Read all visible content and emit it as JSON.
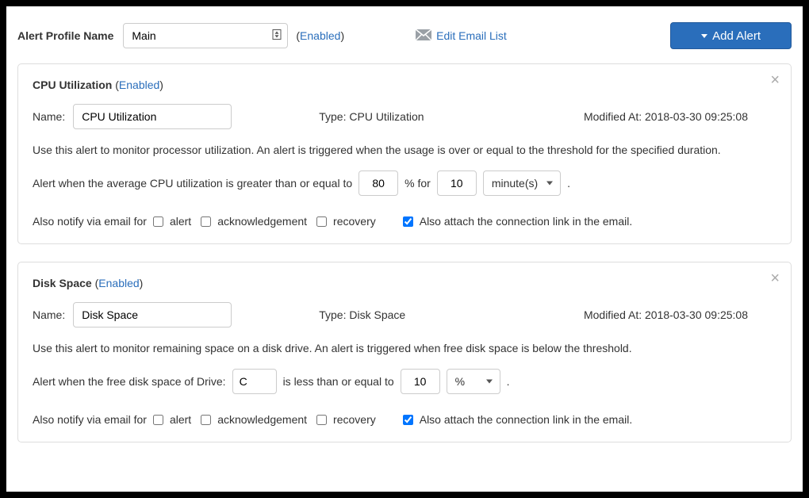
{
  "topbar": {
    "label": "Alert Profile Name",
    "profile_value": "Main",
    "enabled_text": "Enabled",
    "edit_email_label": "Edit Email List",
    "add_alert_label": "Add Alert"
  },
  "alerts": [
    {
      "title": "CPU Utilization",
      "enabled_text": "Enabled",
      "name_label": "Name:",
      "name_value": "CPU Utilization",
      "type_label": "Type:",
      "type_value": "CPU Utilization",
      "modified_label": "Modified At:",
      "modified_value": "2018-03-30 09:25:08",
      "description": "Use this alert to monitor processor utilization. An alert is triggered when the usage is over or equal to the threshold for the specified duration.",
      "config": {
        "prefix": "Alert when the average CPU utilization is greater than or equal to",
        "threshold": "80",
        "pct_for": "% for",
        "duration": "10",
        "unit": "minute(s)"
      },
      "notify": {
        "prefix": "Also notify via email for",
        "alert_label": "alert",
        "ack_label": "acknowledgement",
        "recovery_label": "recovery",
        "attach_label": "Also attach the connection link in the email.",
        "alert_checked": false,
        "ack_checked": false,
        "recovery_checked": false,
        "attach_checked": true
      }
    },
    {
      "title": "Disk Space",
      "enabled_text": "Enabled",
      "name_label": "Name:",
      "name_value": "Disk Space",
      "type_label": "Type:",
      "type_value": "Disk Space",
      "modified_label": "Modified At:",
      "modified_value": "2018-03-30 09:25:08",
      "description": "Use this alert to monitor remaining space on a disk drive. An alert is triggered when free disk space is below the threshold.",
      "config": {
        "prefix": "Alert when the free disk space of Drive:",
        "drive": "C",
        "mid": "is less than or equal to",
        "threshold": "10",
        "unit": "%"
      },
      "notify": {
        "prefix": "Also notify via email for",
        "alert_label": "alert",
        "ack_label": "acknowledgement",
        "recovery_label": "recovery",
        "attach_label": "Also attach the connection link in the email.",
        "alert_checked": false,
        "ack_checked": false,
        "recovery_checked": false,
        "attach_checked": true
      }
    }
  ]
}
